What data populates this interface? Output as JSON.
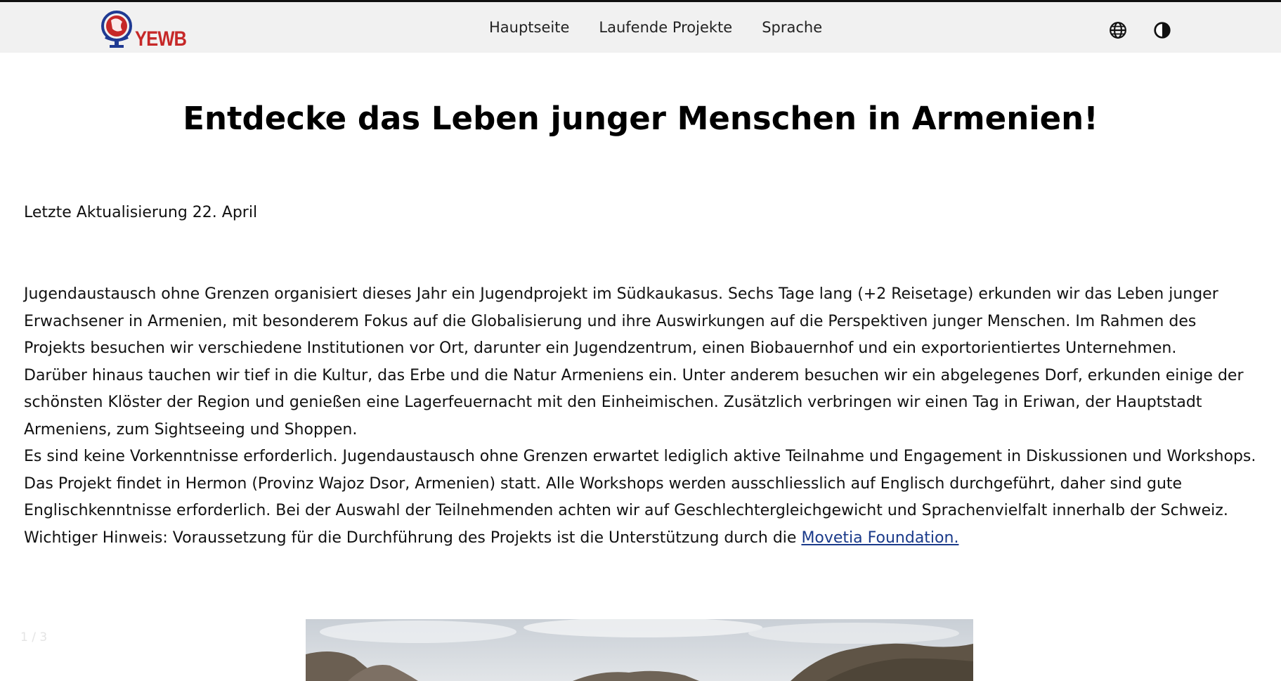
{
  "brand": {
    "logo_text": "YEWB",
    "brand_red": "#c62828",
    "brand_blue": "#1f3a93"
  },
  "nav": {
    "items": [
      {
        "label": "Hauptseite"
      },
      {
        "label": "Laufende Projekte"
      },
      {
        "label": "Sprache"
      }
    ],
    "icons": {
      "language": "globe-icon",
      "theme": "contrast-icon"
    }
  },
  "page": {
    "title": "Entdecke das Leben junger Menschen in Armenien!",
    "updated": "Letzte Aktualisierung 22. April"
  },
  "content": {
    "paragraphs": [
      "Jugendaustausch ohne Grenzen organisiert dieses Jahr ein Jugendprojekt im Südkaukasus. Sechs Tage lang (+2 Reisetage) erkunden wir das Leben junger Erwachsener in Armenien, mit besonderem Fokus auf die Globalisierung und ihre Auswirkungen auf die Perspektiven junger Menschen. Im Rahmen des Projekts besuchen wir verschiedene Institutionen vor Ort, darunter ein Jugendzentrum, einen Biobauernhof und ein exportorientiertes Unternehmen.",
      "Darüber hinaus tauchen wir tief in die Kultur, das Erbe und die Natur Armeniens ein. Unter anderem besuchen wir ein abgelegenes Dorf, erkunden einige der schönsten Klöster der Region und genießen eine Lagerfeuernacht mit den Einheimischen. Zusätzlich verbringen wir einen Tag in Eriwan, der Hauptstadt Armeniens, zum Sightseeing und Shoppen.",
      "Es sind keine Vorkenntnisse erforderlich. Jugendaustausch ohne Grenzen erwartet lediglich aktive Teilnahme und Engagement in Diskussionen und Workshops.",
      "Das Projekt findet in Hermon (Provinz Wajoz Dsor, Armenien) statt. Alle Workshops werden ausschliesslich auf Englisch durchgeführt, daher sind gute Englischkenntnisse erforderlich. Bei der Auswahl der Teilnehmenden achten wir auf Geschlechtergleichgewicht und Sprachenvielfalt innerhalb der Schweiz."
    ],
    "notice_prefix": "Wichtiger Hinweis: Voraussetzung für die Durchführung des Projekts ist die Unterstützung durch die ",
    "notice_link": "Movetia Foundation."
  },
  "carousel": {
    "counter": "1 / 3"
  }
}
